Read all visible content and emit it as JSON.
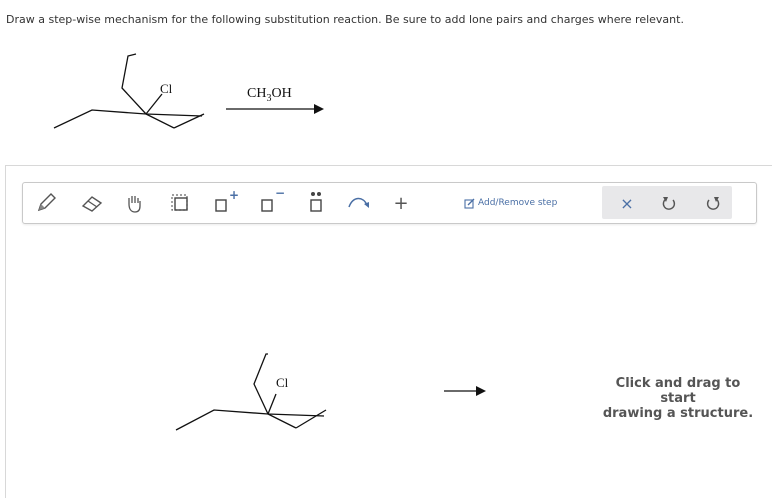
{
  "question": {
    "prompt": "Draw a step-wise mechanism for the following substitution reaction. Be sure to add lone pairs and charges where relevant.",
    "reagent_main": "CH",
    "reagent_sub": "3",
    "reagent_tail": "OH",
    "substituent_label": "Cl"
  },
  "toolbar": {
    "tools": [
      {
        "name": "pencil-tool",
        "icon": "pencil-icon"
      },
      {
        "name": "eraser-tool",
        "icon": "eraser-icon"
      },
      {
        "name": "hand-tool",
        "icon": "hand-icon"
      },
      {
        "name": "select-tool",
        "icon": "dashed-square-icon"
      },
      {
        "name": "positive-charge-tool",
        "icon": "plus-charge-icon",
        "mark": "+"
      },
      {
        "name": "negative-charge-tool",
        "icon": "minus-charge-icon",
        "mark": "−"
      },
      {
        "name": "lone-pair-tool",
        "icon": "lone-pair-icon"
      },
      {
        "name": "curved-arrow-tool",
        "icon": "curved-arrow-icon"
      },
      {
        "name": "add-tool",
        "icon": "plus-icon",
        "mark": "+"
      }
    ],
    "add_remove_label": "Add/Remove step",
    "clear_mark": "×",
    "undo_icon": "undo-icon",
    "redo_icon": "redo-icon"
  },
  "workspace": {
    "substituent_label": "Cl",
    "hint_line1": "Click and drag to start",
    "hint_line2": "drawing a structure."
  }
}
